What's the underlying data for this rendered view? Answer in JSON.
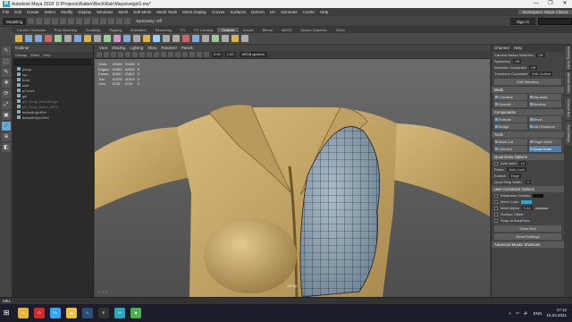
{
  "app": {
    "logo": "M",
    "title": "Autodesk Maya 2018: D:\\Projects\\Ratten\\Rech\\Ratr\\Maya\\vetgirl1.ma*",
    "window_controls": [
      "—",
      "❐",
      "✕"
    ]
  },
  "menubar": {
    "items": [
      "File",
      "Edit",
      "Create",
      "Select",
      "Modify",
      "Display",
      "Windows",
      "Mesh",
      "Edit Mesh",
      "Mesh Tools",
      "Mesh Display",
      "Curves",
      "Surfaces",
      "Deform",
      "UV",
      "Generate",
      "Cache",
      "Help"
    ],
    "workspace_label": "Workspace: Maya Classic"
  },
  "statusline": {
    "mode": "Modeling",
    "symmetry": "Symmetry: Off",
    "sign_in": "Sign In"
  },
  "shelf": {
    "tabs": [
      "Curves / Surfaces",
      "Poly Modeling",
      "Sculpting",
      "Rigging",
      "Animation",
      "Rendering",
      "FX",
      "FX Caching",
      "Custom",
      "Arnold",
      "Bifrost",
      "MASH",
      "Motion Graphics",
      "XGen"
    ],
    "active_tab": "Custom",
    "icon_colors": [
      "#d9b44a",
      "#7fa8d9",
      "#7fa8d9",
      "#c66",
      "#9c9",
      "#aaa",
      "#7fa8d9",
      "#d9b44a",
      "#aaa",
      "#9c9",
      "#c9c",
      "#7fa8d9",
      "#aaa",
      "#d9b44a",
      "#9cf",
      "#aaa",
      "#aaa",
      "#c66",
      "#7fa8d9",
      "#aaa",
      "#9c9",
      "#aaa",
      "#d9b44a",
      "#aaa"
    ]
  },
  "toolbox": {
    "tools": [
      "↖",
      "⬚",
      "✎",
      "✥",
      "⟳",
      "⤢",
      "▣",
      "⟋",
      "⊕",
      "◧"
    ],
    "active_index": 7
  },
  "outliner": {
    "title": "Outliner",
    "menu": [
      "Display",
      "Show",
      "Help"
    ],
    "items": [
      {
        "label": "persp",
        "dim": false
      },
      {
        "label": "top",
        "dim": false
      },
      {
        "label": "front",
        "dim": false
      },
      {
        "label": "side",
        "dim": false
      },
      {
        "label": "pCube1",
        "dim": false
      },
      {
        "label": "girl",
        "dim": false
      },
      {
        "label": "girl_Body_blendShape",
        "dim": true
      },
      {
        "label": "girl_Body_Base_bSPs",
        "dim": true
      },
      {
        "label": "defaultLightSet",
        "dim": false
      },
      {
        "label": "defaultObjectSet",
        "dim": false
      }
    ]
  },
  "viewport": {
    "menu": [
      "View",
      "Shading",
      "Lighting",
      "Show",
      "Renderer",
      "Panels"
    ],
    "num1": "0.00",
    "num2": "1.00",
    "colorspace": "sRGB gamma",
    "hud_rows": [
      [
        "Verts:",
        "21666",
        "21666",
        "0"
      ],
      [
        "Edges:",
        "42553",
        "42553",
        "0"
      ],
      [
        "Faces:",
        "21687",
        "21687",
        "0"
      ],
      [
        "Tris:",
        "41929",
        "41929",
        "0"
      ],
      [
        "UVs:",
        "4726",
        "4726",
        "0"
      ]
    ],
    "camera": "persp",
    "axis": {
      "x": "X",
      "y": "Y",
      "z": "Z"
    }
  },
  "rightpanel": {
    "tabs": [
      "Channel",
      "Help"
    ],
    "lines": [
      {
        "label": "Camera Based Selection",
        "value": "Off"
      },
      {
        "label": "Symmetry",
        "value": "Off"
      },
      {
        "label": "Selection Constraint",
        "value": "Off"
      },
      {
        "label": "Transform Constraint",
        "value": "Edit Outline"
      }
    ],
    "soft_selection": "Soft Selection",
    "mesh": {
      "title": "Mesh",
      "buttons": [
        "Combine",
        "Separate",
        "Smooth",
        "Boolean"
      ]
    },
    "components": {
      "title": "Components",
      "buttons": [
        "Extrude",
        "Bevel",
        "Bridge",
        "Add Divisions"
      ]
    },
    "tools": {
      "title": "Tools",
      "buttons": [
        "Multi-Cut",
        "Target Weld",
        "Connect",
        "Quad Draw"
      ],
      "active": "Quad Draw"
    },
    "quad_draw": {
      "title": "Quad Draw Options",
      "auto_weld_label": "Auto weld",
      "auto_weld_value": "10",
      "relax_label": "Relax:",
      "relax_value": "Auto Lock",
      "extend_label": "Extend:",
      "extend_value": "Edge",
      "strip_label": "Quad Strip Width:",
      "strip_value": "0"
    },
    "user_colors": {
      "title": "User Constraint Options",
      "wireframe_label": "Wireframe Overlay",
      "wireframe_color": "#111111",
      "mesh_color_label": "Mesh Color",
      "mesh_color": "#2ba7d6",
      "alpha_label": "Mesh Alpha",
      "alpha_value": "0.44",
      "opacity_label": "Surface Offset",
      "backface_label": "Snap to BackFace"
    },
    "clear_grid": "Clear Grid",
    "reset_settings": "Reset Settings",
    "advanced": "Advanced Mouse Shortcuts"
  },
  "sidetabs": [
    "Modeling Toolkit",
    "Attribute Editor",
    "Channel Box",
    "Tool Settings"
  ],
  "timebar": {
    "label": "MEL"
  },
  "taskbar": {
    "apps": [
      {
        "name": "explorer",
        "color": "#e8b53c",
        "glyph": "▭"
      },
      {
        "name": "opera",
        "color": "#d42a2a",
        "glyph": "O"
      },
      {
        "name": "photoshop",
        "color": "#31a8ff",
        "glyph": "Ps"
      },
      {
        "name": "folder",
        "color": "#f0c040",
        "glyph": "▬"
      },
      {
        "name": "steam",
        "color": "#2b4e78",
        "glyph": "♨"
      },
      {
        "name": "epic",
        "color": "#333",
        "glyph": "E"
      },
      {
        "name": "maya",
        "color": "#2aa7b8",
        "glyph": "M"
      },
      {
        "name": "app",
        "color": "#4caf50",
        "glyph": "◆"
      }
    ],
    "lang": "ENG",
    "time": "17:12",
    "date": "15.03.2021"
  },
  "colors": {
    "skin": "#c7a86a",
    "wire_mesh": "#8aa0b0",
    "accent": "#4d7fb0"
  }
}
